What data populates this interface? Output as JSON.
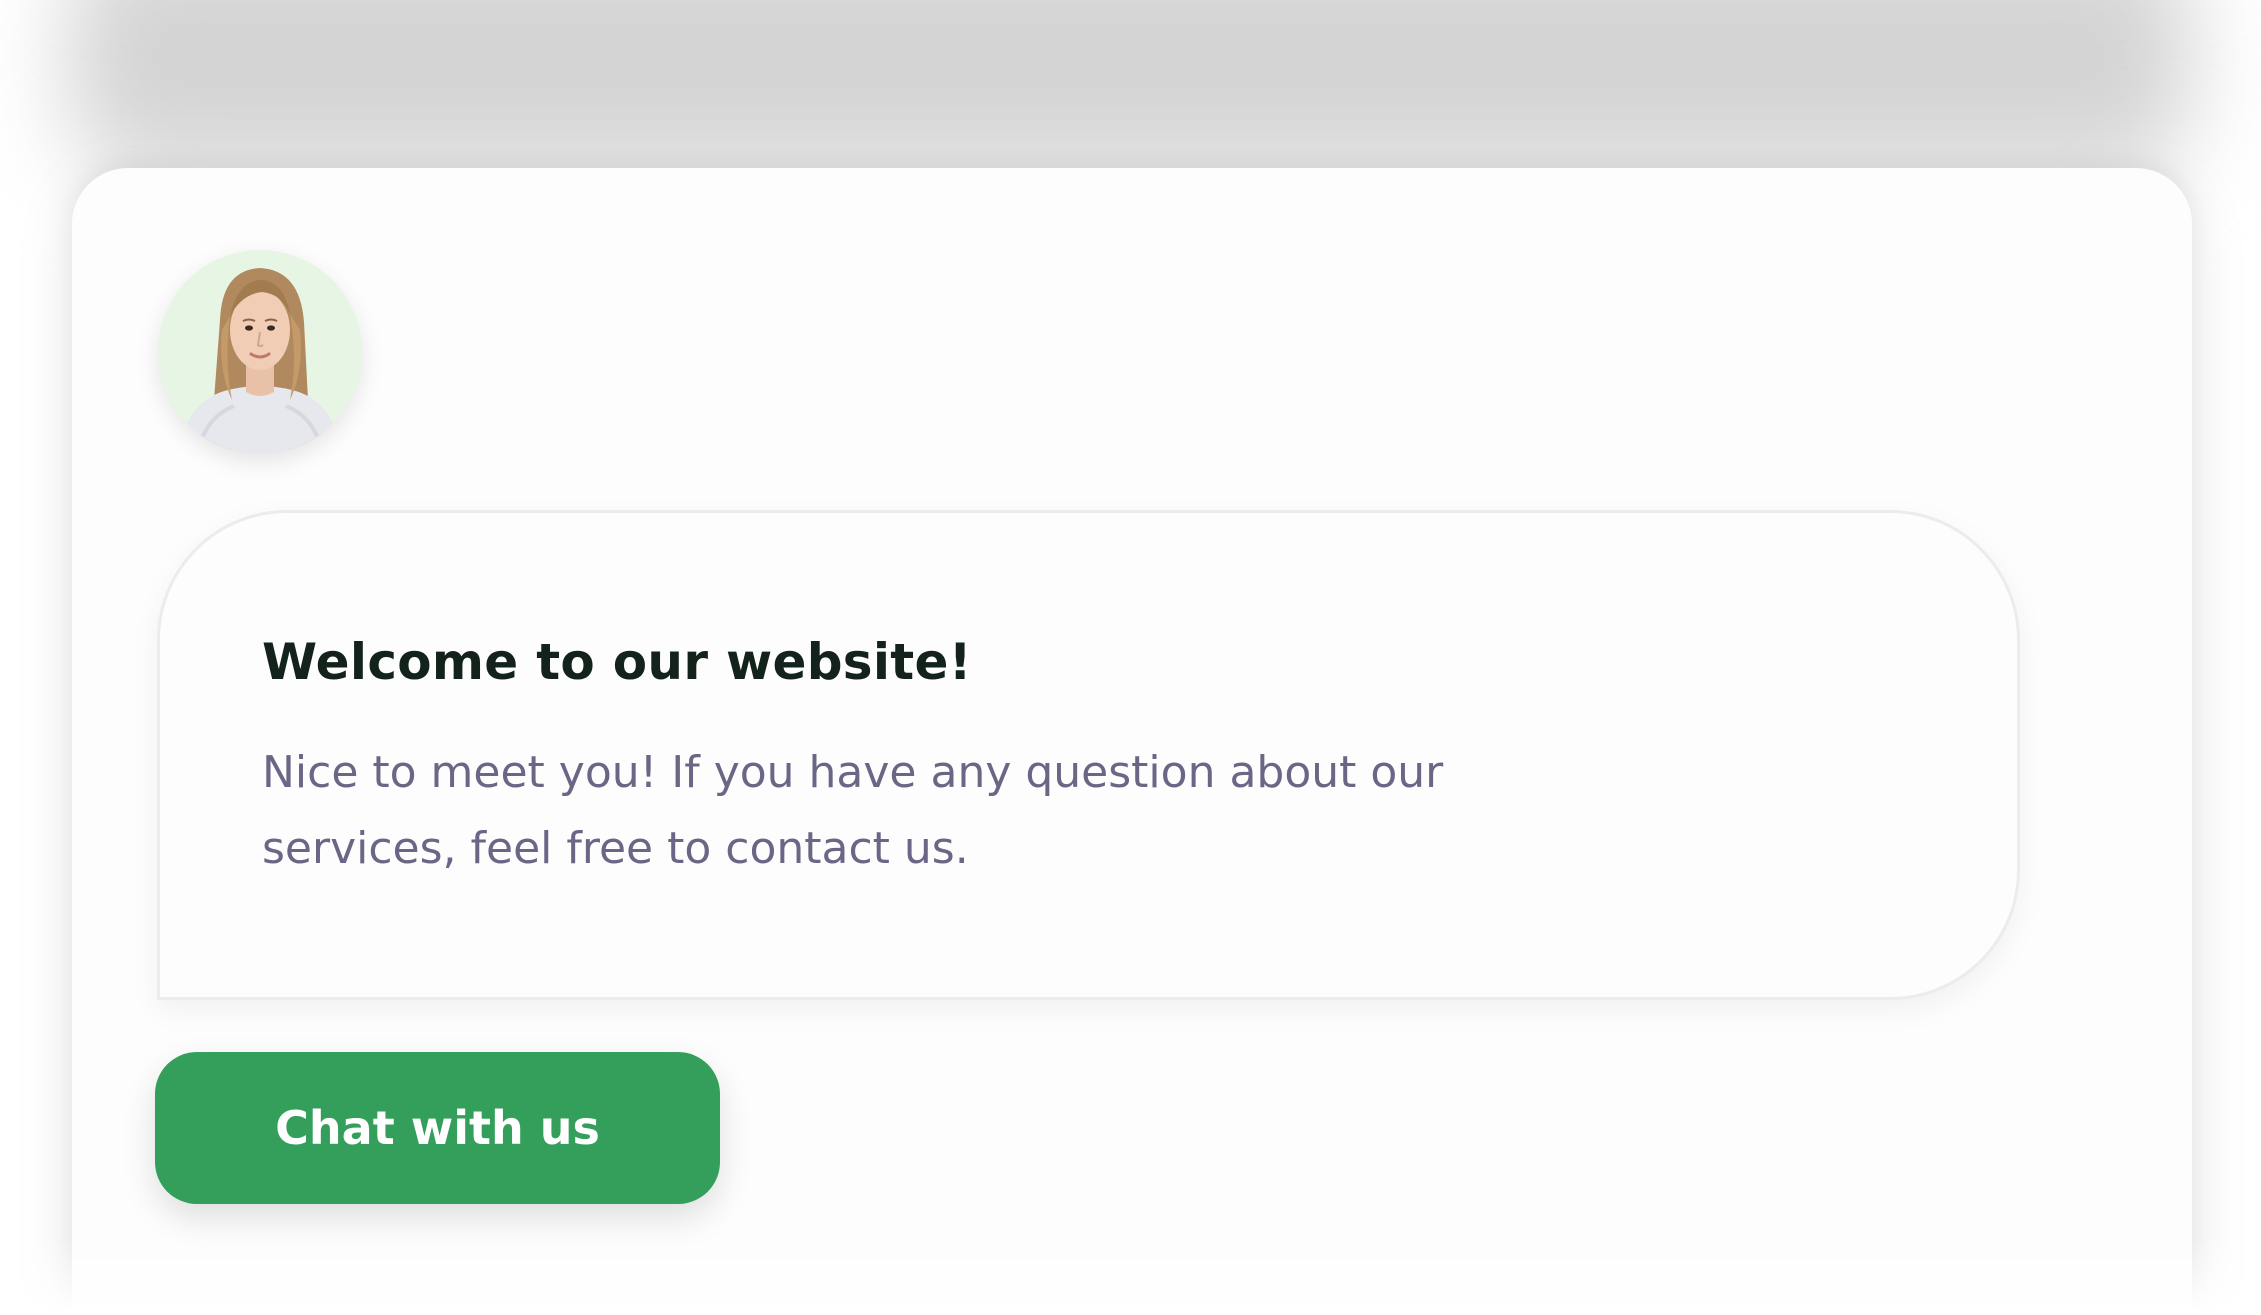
{
  "widget": {
    "avatar_alt": "Support agent avatar",
    "title": "Welcome to our website!",
    "message": "Nice to meet you! If you have any question about our services, feel free to contact us.",
    "cta_label": "Chat with us"
  },
  "colors": {
    "accent": "#339f5b",
    "title": "#14221c",
    "body_text": "#6b6686",
    "avatar_bg": "#e7f6e4"
  },
  "icons": [
    "user-avatar-photo"
  ]
}
